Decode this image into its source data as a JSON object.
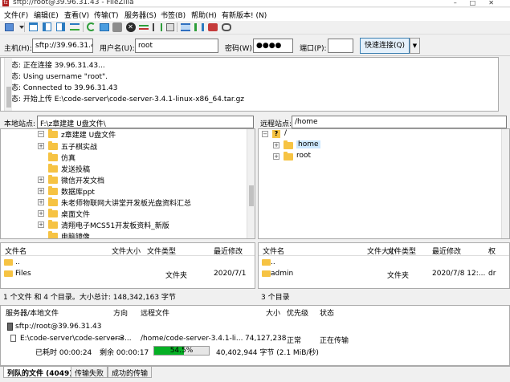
{
  "window": {
    "title": "sftp://root@39.96.31.43 - FileZilla"
  },
  "menu": [
    "文件(F)",
    "编辑(E)",
    "查看(V)",
    "传输(T)",
    "服务器(S)",
    "书签(B)",
    "帮助(H)",
    "有新版本! (N)"
  ],
  "toolbar": [
    "site-manager-icon",
    "toggle-log-icon",
    "toggle-local-tree-icon",
    "toggle-remote-tree-icon",
    "toggle-queue-icon",
    "refresh-icon",
    "process-queue-icon",
    "cancel-icon",
    "disconnect-icon",
    "reconnect-icon",
    "filter-icon",
    "compare-icon",
    "sync-browse-icon",
    "search-icon"
  ],
  "quickconnect": {
    "host_label": "主机(H):",
    "host_value": "sftp://39.96.31.43",
    "user_label": "用户名(U):",
    "user_value": "root",
    "pass_label": "密码(W):",
    "pass_value": "●●●●",
    "port_label": "端口(P):",
    "port_value": "",
    "connect_label": "快速连接(Q)",
    "dropdown": "▼"
  },
  "log": [
    "状态: 正在连接 39.96.31.43...",
    "状态: Using username \"root\".",
    "状态: Connected to 39.96.31.43",
    "状态: 开始上传 E:\\code-server\\code-server-3.4.1-linux-x86_64.tar.gz"
  ],
  "local": {
    "site_label": "本地站点:",
    "path": "F:\\z章建建 U盘文件\\",
    "tree": [
      "z章建建 U盘文件",
      "五子棋实战",
      "仿真",
      "发送投稿",
      "微信开发文档",
      "数据库ppt",
      "朱老师物联网大讲堂开发板光盘资料汇总",
      "桌面文件",
      "清翔电子MCS51开发板资料_新版",
      "电脑镜像"
    ],
    "headers": {
      "name": "文件名",
      "size": "文件大小",
      "type": "文件类型",
      "modified": "最近修改"
    },
    "rows": [
      {
        "name": "..",
        "size": "",
        "type": "",
        "modified": ""
      },
      {
        "name": "Files",
        "size": "",
        "type": "文件夹",
        "modified": "2020/7/1"
      }
    ],
    "status": "1 个文件 和 4 个目录。大小总计: 148,342,163 字节"
  },
  "remote": {
    "site_label": "远程站点:",
    "path": "/home",
    "tree_root": "/",
    "tree": [
      "home",
      "root"
    ],
    "headers": {
      "name": "文件名",
      "size": "文件大小",
      "type": "文件类型",
      "modified": "最近修改",
      "perm": "权"
    },
    "rows": [
      {
        "name": "..",
        "size": "",
        "type": "",
        "modified": "",
        "perm": ""
      },
      {
        "name": "admin",
        "size": "",
        "type": "文件夹",
        "modified": "2020/7/8 12:...",
        "perm": "dr"
      }
    ],
    "status": "3 个目录"
  },
  "queue": {
    "headers": {
      "server": "服务器/本地文件",
      "direction": "方向",
      "remote": "远程文件",
      "size": "大小",
      "priority": "优先级",
      "status": "状态"
    },
    "server": "sftp://root@39.96.31.43",
    "local_file": "E:\\code-server\\code-server-3...",
    "direction": "-->",
    "remote_file": "/home/code-server-3.4.1-li...",
    "size": "74,127,238",
    "priority": "正常",
    "state": "正在传输",
    "elapsed": "已耗时 00:00:24",
    "remaining": "剩余 00:00:17",
    "progress_label": "54.5%",
    "progress": 0.545,
    "transferred": "40,402,944 字节 (2.1 MiB/秒)"
  },
  "tabs": [
    "列队的文件 (4049)",
    "传输失败",
    "成功的传输"
  ]
}
